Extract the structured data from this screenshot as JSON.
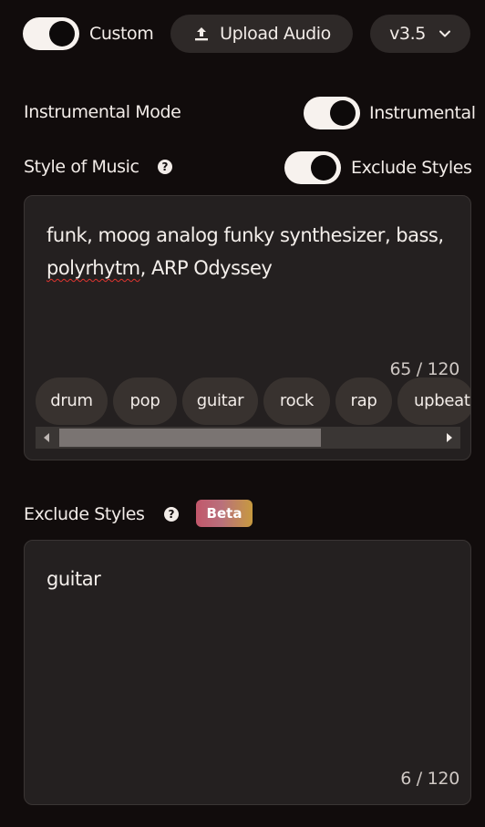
{
  "top": {
    "custom_label": "Custom",
    "upload_label": "Upload Audio",
    "version_label": "v3.5"
  },
  "instrumental": {
    "heading": "Instrumental Mode",
    "toggle_label": "Instrumental"
  },
  "style": {
    "heading": "Style of Music",
    "exclude_toggle_label": "Exclude Styles",
    "text_part1": "funk, moog analog funky synthesizer, bass, ",
    "text_misspelled": "polyrhytm",
    "text_part2": ", ARP Odyssey",
    "counter": "65 / 120",
    "tags": [
      "drum",
      "pop",
      "guitar",
      "rock",
      "rap",
      "upbeat"
    ]
  },
  "exclude": {
    "heading": "Exclude Styles",
    "badge": "Beta",
    "text": "guitar",
    "counter": "6 / 120"
  },
  "colors": {
    "background": "#110c0c",
    "panel": "#242020",
    "button": "#2e2928",
    "toggle_track": "#f7f2ee",
    "toggle_knob": "#0d0a0a",
    "spellcheck": "#e0342f"
  },
  "icons": {
    "upload": "upload-icon",
    "chevron": "chevron-down-icon",
    "help": "question-circle-icon"
  }
}
